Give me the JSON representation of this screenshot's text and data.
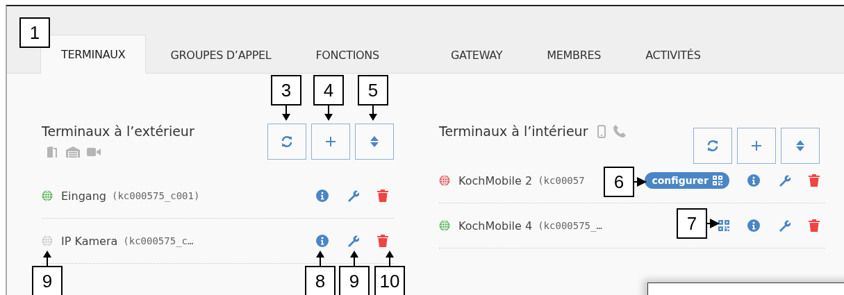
{
  "tabs": [
    {
      "label": "TERMINAUX",
      "selected": true
    },
    {
      "label": "GROUPES D’APPEL",
      "selected": false
    },
    {
      "label": "FONCTIONS",
      "selected": false
    },
    {
      "label": "GATEWAY",
      "selected": false
    },
    {
      "label": "MEMBRES",
      "selected": false
    },
    {
      "label": "ACTIVITÉS",
      "selected": false
    }
  ],
  "sections": [
    {
      "kind": "outdoor",
      "title": "Terminaux à l’extérieur",
      "rows": [
        {
          "name": "Eingang",
          "id": "(kc000575_c001)",
          "color": "#5cb85c"
        },
        {
          "name": "IP Kamera",
          "id": "(kc000575_c…",
          "color": "#cccccc"
        }
      ]
    },
    {
      "kind": "indoor",
      "title": "Terminaux à l’intérieur",
      "rows": [
        {
          "name": "KochMobile 2",
          "id": "(kc00057",
          "color": "#e05a55",
          "config": {
            "kind": "badge",
            "label": "configurer"
          }
        },
        {
          "name": "KochMobile 4",
          "id": "(kc000575_…",
          "color": "#5cb85c",
          "config": {
            "kind": "icon"
          }
        }
      ]
    }
  ],
  "callouts": [
    {
      "label": "1",
      "kind": "plain"
    },
    {
      "label": "3",
      "kind": "down"
    },
    {
      "label": "4",
      "kind": "down"
    },
    {
      "label": "5",
      "kind": "down"
    },
    {
      "label": "6",
      "kind": "right"
    },
    {
      "label": "7",
      "kind": "right"
    },
    {
      "label": "9",
      "kind": "up"
    },
    {
      "label": "8",
      "kind": "up"
    },
    {
      "label": "9",
      "kind": "up"
    },
    {
      "label": "10",
      "kind": "up"
    }
  ]
}
